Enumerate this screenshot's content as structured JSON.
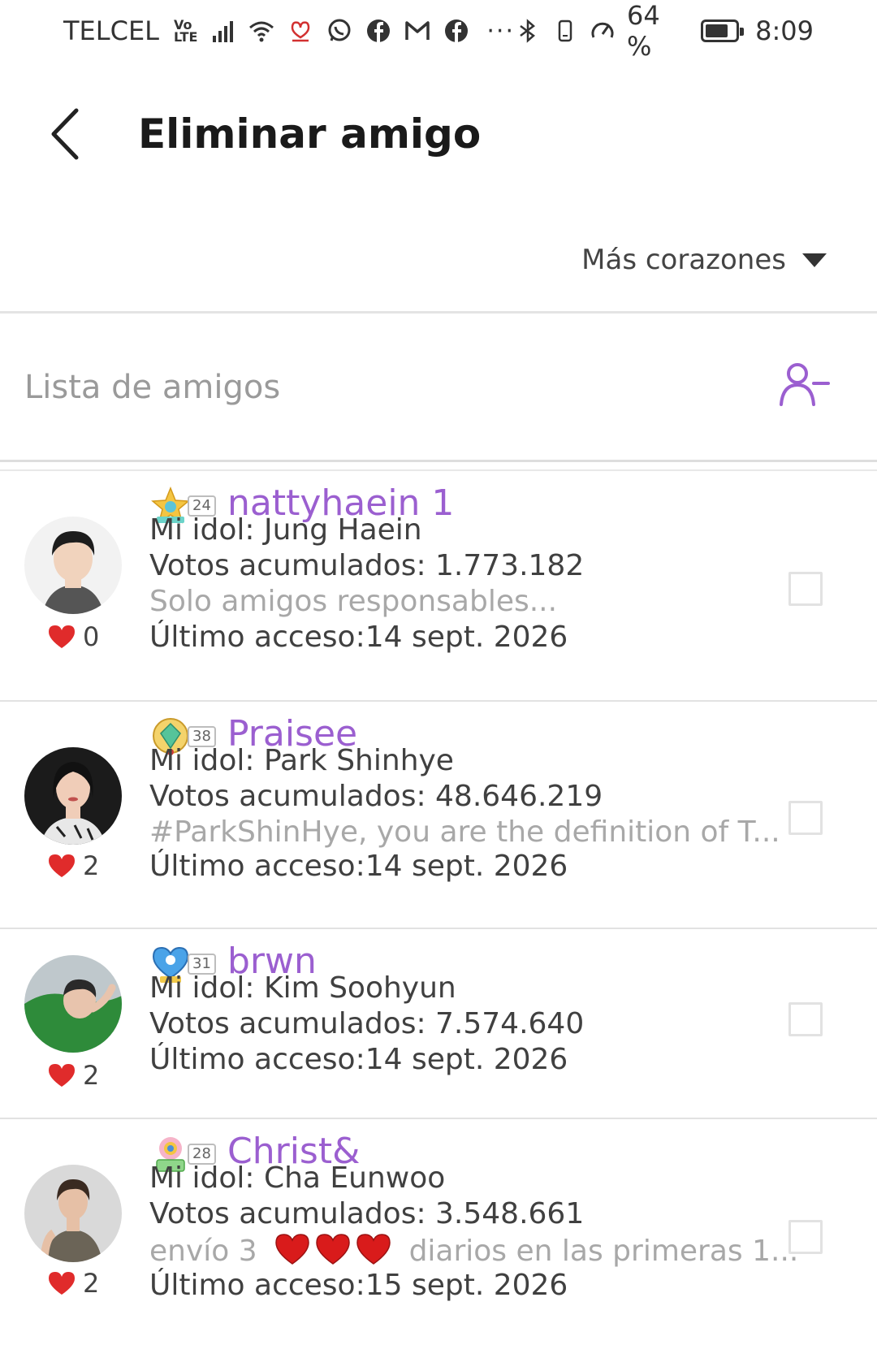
{
  "status_bar": {
    "carrier": "TELCEL",
    "volte_top": "Vo",
    "volte_bottom": "LTE",
    "battery_percent": "64 %",
    "battery_level": 0.64,
    "time": "8:09",
    "icons": [
      "signal-icon",
      "wifi-icon",
      "app-notification-icon",
      "whatsapp-icon",
      "facebook-icon",
      "gmail-icon",
      "facebook-icon",
      "more-icon",
      "bluetooth-icon",
      "vibrate-icon",
      "speed-icon",
      "battery-icon"
    ]
  },
  "header": {
    "title": "Eliminar amigo",
    "back_icon": "chevron-left-icon"
  },
  "sort": {
    "label": "Más corazones"
  },
  "list": {
    "title": "Lista de amigos",
    "action_icon": "remove-user-icon"
  },
  "friends": [
    {
      "name": "nattyhaein 1",
      "level": "24",
      "hearts": "0",
      "idol": "Mi idol: Jung Haein",
      "votes": "Votos acumulados: 1.773.182",
      "bio": "Solo amigos responsables...",
      "last_access": "Último acceso:14 sept. 2026",
      "colors": {
        "avatar_bg": "#f2f2f2",
        "skin": "#f1d3bd",
        "hair": "#1d1d1d",
        "shirt": "#555555"
      }
    },
    {
      "name": "Praisee",
      "level": "38",
      "hearts": "2",
      "idol": "Mi idol: Park Shinhye",
      "votes": "Votos acumulados: 48.646.219",
      "bio": "#ParkShinHye, you are the definition of T...",
      "last_access": "Último acceso:14 sept. 2026",
      "colors": {
        "avatar_bg": "#1b1b1b",
        "skin": "#f0cdb8",
        "hair": "#111111",
        "shirt": "#e8e8e8"
      }
    },
    {
      "name": "brwn",
      "level": "31",
      "hearts": "2",
      "idol": "Mi idol: Kim Soohyun",
      "votes": "Votos acumulados: 7.574.640",
      "bio": "",
      "last_access": "Último acceso:14 sept. 2026",
      "colors": {
        "avatar_bg": "#bfc8cc",
        "skin": "#e8c4ad",
        "hair": "#2a2a2a",
        "shirt": "#2e8b3a"
      }
    },
    {
      "name": "Christ&",
      "level": "28",
      "hearts": "2",
      "idol": "Mi idol: Cha Eunwoo",
      "votes": "Votos acumulados: 3.548.661",
      "bio_start": "envío 3",
      "bio_end": "diarios en las primeras 1...",
      "last_access": "Último acceso:15 sept. 2026",
      "colors": {
        "avatar_bg": "#d9d9d9",
        "skin": "#e6c0a6",
        "hair": "#3a2a20",
        "shirt": "#6b6457"
      }
    }
  ],
  "colors": {
    "accent": "#9b5fd0",
    "heart": "#e02b2b",
    "muted_text": "#a8a8a8"
  }
}
